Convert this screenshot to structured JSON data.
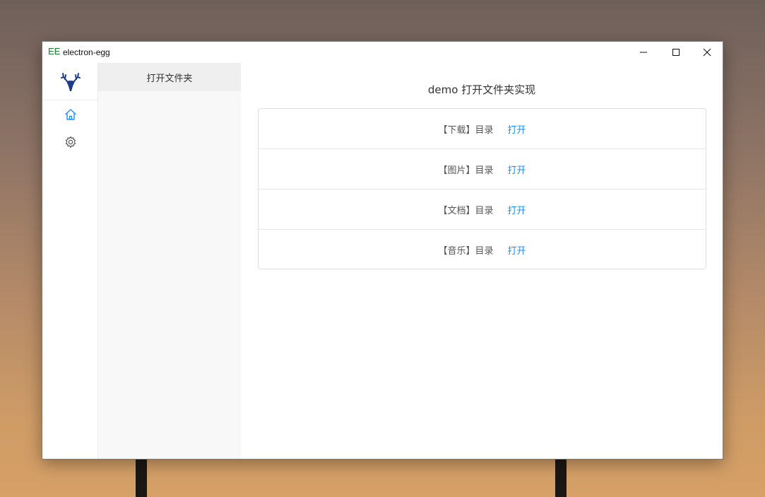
{
  "window": {
    "icon_text": "EE",
    "title": "electron-egg"
  },
  "rail": {
    "logo": "deer-logo-icon",
    "items": [
      {
        "icon": "home-icon",
        "active": true
      },
      {
        "icon": "gear-icon",
        "active": false
      }
    ]
  },
  "menu": {
    "items": [
      {
        "label": "打开文件夹",
        "selected": true
      }
    ]
  },
  "main": {
    "title": "demo 打开文件夹实现",
    "rows": [
      {
        "label": "【下载】目录",
        "action": "打开"
      },
      {
        "label": "【图片】目录",
        "action": "打开"
      },
      {
        "label": "【文档】目录",
        "action": "打开"
      },
      {
        "label": "【音乐】目录",
        "action": "打开"
      }
    ]
  },
  "colors": {
    "accent": "#1890ff",
    "logo": "#1f3c88",
    "app_icon": "#1a7f2a"
  }
}
